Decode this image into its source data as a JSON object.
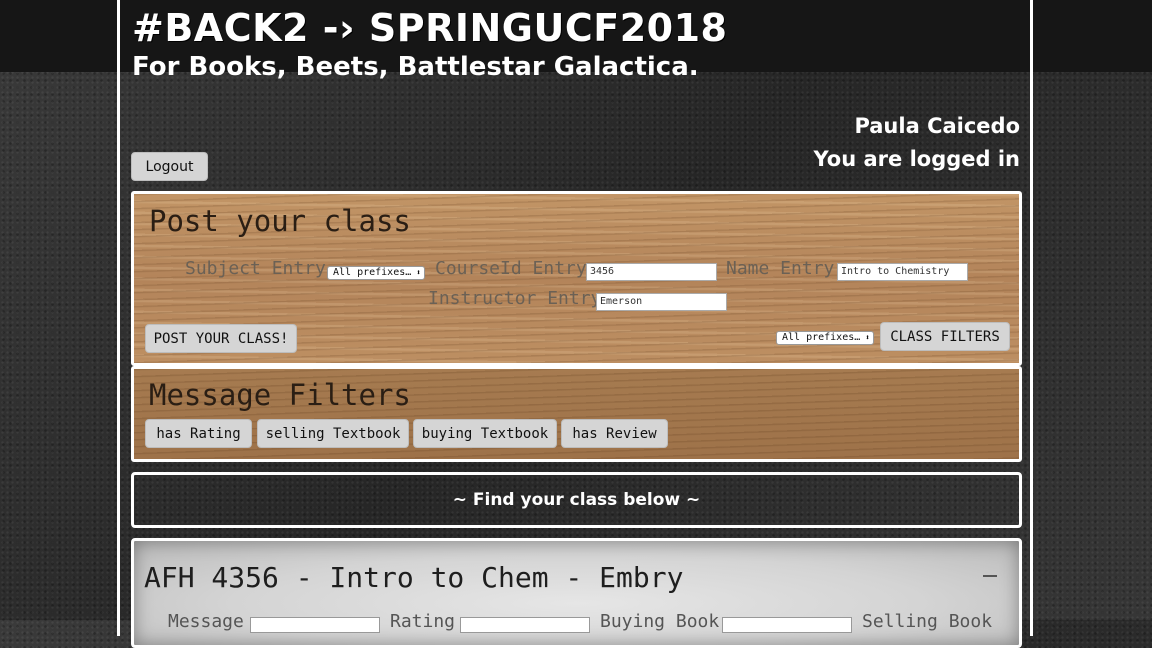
{
  "header": {
    "site_title": "#BACK2 -› SPRINGUCF2018",
    "site_subtitle": "For Books, Beets, Battlestar Galactica."
  },
  "user": {
    "name": "Paula Caicedo",
    "status": "You are logged in",
    "logout_label": "Logout"
  },
  "post_panel": {
    "title": "Post your class",
    "subject_label": "Subject Entry",
    "subject_select": "All prefixes…",
    "course_id_label": "CourseId Entry",
    "course_id_value": "3456",
    "name_label": "Name Entry",
    "name_value": "Intro to Chemistry",
    "instructor_label": "Instructor Entry",
    "instructor_value": "Emerson",
    "post_button": "POST YOUR CLASS!",
    "filter_select": "All prefixes…",
    "class_filters_button": "CLASS FILTERS"
  },
  "message_filters": {
    "title": "Message Filters",
    "chips": [
      "has Rating",
      "selling Textbook",
      "buying Textbook",
      "has Review"
    ]
  },
  "find_bar": {
    "text": "~ Find your class below ~"
  },
  "class_card": {
    "title": "AFH 4356 - Intro to Chem - Embry",
    "collapse_symbol": "–",
    "field_labels": [
      "Message",
      "Rating",
      "Buying Book",
      "Selling Book"
    ]
  },
  "colors": {
    "background": "#2f2f2f",
    "header_bar": "#161616",
    "wood": "#b98a5e",
    "border": "#ffffff",
    "button": "#d5d5d5"
  }
}
